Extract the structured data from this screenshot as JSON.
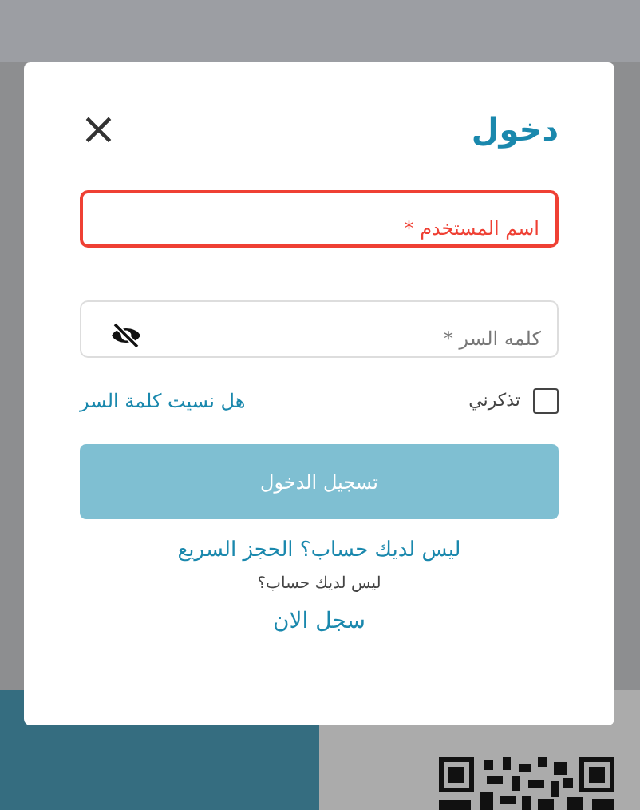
{
  "dialog": {
    "title": "دخول",
    "close_icon": "×"
  },
  "fields": [
    {
      "kind": "text",
      "placeholder": "اسم المستخدم *",
      "invalid": true
    },
    {
      "kind": "password",
      "placeholder": "كلمه السر *",
      "invalid": false
    }
  ],
  "remember": {
    "label": "تذكرني",
    "checked": false
  },
  "forgot_link": "هل نسيت كلمة السر",
  "login_button": {
    "label": "تسجيل الدخول",
    "disabled": true
  },
  "quick_booking_link": "ليس لديك حساب؟ الحجز السريع",
  "no_account_text": "ليس لديك حساب؟",
  "register_link": "سجل الان"
}
